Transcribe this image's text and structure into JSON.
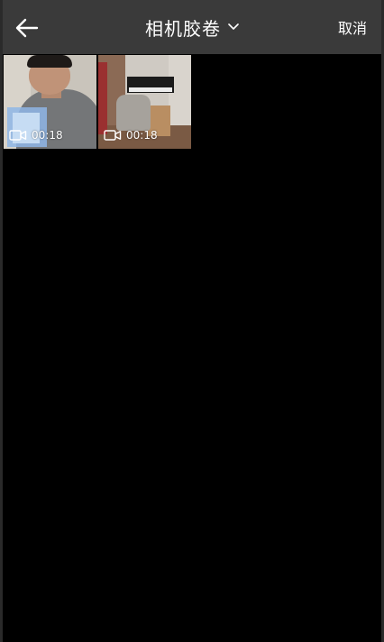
{
  "header": {
    "back_icon": "arrow-left-icon",
    "title": "相机胶卷",
    "title_dropdown_icon": "chevron-down-icon",
    "cancel_label": "取消"
  },
  "media": [
    {
      "type_icon": "video-camera-icon",
      "duration": "00:18"
    },
    {
      "type_icon": "video-camera-icon",
      "duration": "00:18"
    }
  ],
  "colors": {
    "topbar_bg": "#3a3a3a",
    "screen_bg": "#000000",
    "text": "#ffffff"
  }
}
